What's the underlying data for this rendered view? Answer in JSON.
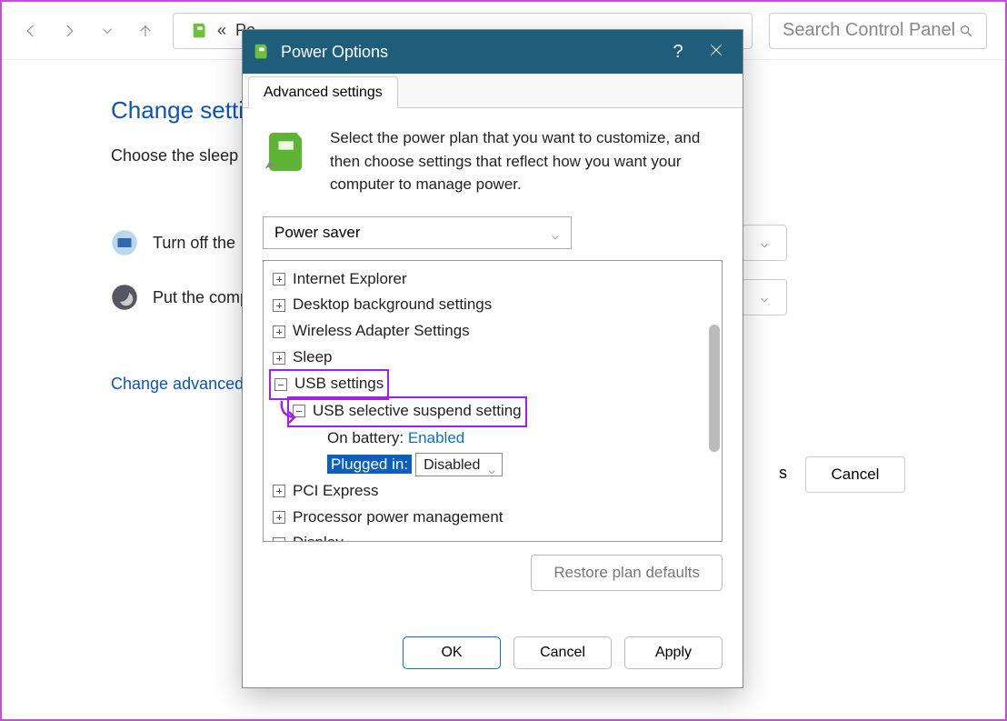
{
  "bg": {
    "breadcrumb_prefix": "«",
    "breadcrumb_text": "Po",
    "search_placeholder": "Search Control Panel",
    "heading": "Change setti",
    "subtext": "Choose the sleep",
    "row1_label": "Turn off the",
    "row2_label": "Put the comp",
    "link_text": "Change advanced",
    "partial_s": "s",
    "cancel_label": "Cancel"
  },
  "dialog": {
    "title": "Power Options",
    "tab_label": "Advanced settings",
    "intro": "Select the power plan that you want to customize, and then choose settings that reflect how you want your computer to manage power.",
    "plan": "Power saver",
    "tree": {
      "ie": "Internet Explorer",
      "desktop_bg": "Desktop background settings",
      "wireless": "Wireless Adapter Settings",
      "sleep": "Sleep",
      "usb": "USB settings",
      "usb_sub": "USB selective suspend setting",
      "on_battery_label": "On battery:",
      "on_battery_value": "Enabled",
      "plugged_in_label": "Plugged in:",
      "plugged_in_value": "Disabled",
      "pci": "PCI Express",
      "cpu": "Processor power management",
      "display": "Display"
    },
    "restore_label": "Restore plan defaults",
    "ok_label": "OK",
    "cancel_label": "Cancel",
    "apply_label": "Apply"
  }
}
